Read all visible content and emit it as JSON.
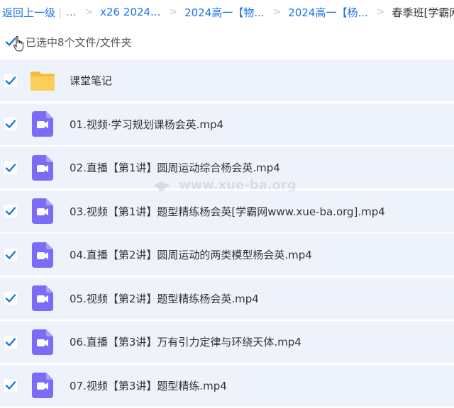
{
  "breadcrumb": {
    "back": "返回上一级",
    "ellipsis": "...",
    "items": [
      "x26 2024...",
      "2024高一【物...",
      "2024高一【杨..."
    ],
    "current": "春季班[学霸网w..."
  },
  "selection": {
    "text": "已选中8个文件/文件夹",
    "all_checked": true
  },
  "files": [
    {
      "name": "课堂笔记",
      "type": "folder",
      "checked": true
    },
    {
      "name": "01.视频·学习规划课杨会英.mp4",
      "type": "video",
      "checked": true
    },
    {
      "name": "02.直播【第1讲】圆周运动综合杨会英.mp4",
      "type": "video",
      "checked": true
    },
    {
      "name": "03.视频【第1讲】题型精练杨会英[学霸网www.xue-ba.org].mp4",
      "type": "video",
      "checked": true
    },
    {
      "name": "04.直播【第2讲】圆周运动的两类模型杨会英.mp4",
      "type": "video",
      "checked": true
    },
    {
      "name": "05.视频【第2讲】题型精练杨会英.mp4",
      "type": "video",
      "checked": true
    },
    {
      "name": "06.直播【第3讲】万有引力定律与环绕天体.mp4",
      "type": "video",
      "checked": true
    },
    {
      "name": "07.视频【第3讲】题型精练.mp4",
      "type": "video",
      "checked": true
    }
  ],
  "watermark": "www.xue-ba.org",
  "colors": {
    "accent": "#1a73e8",
    "video_icon": "#7b6cf6",
    "folder": "#f7c94b",
    "row_bg": "#eef3fb"
  }
}
